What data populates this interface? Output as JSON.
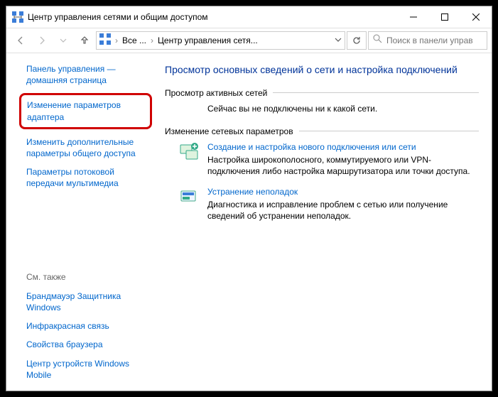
{
  "window": {
    "title": "Центр управления сетями и общим доступом"
  },
  "address": {
    "seg1": "Все ...",
    "seg2": "Центр управления сетя..."
  },
  "search": {
    "placeholder": "Поиск в панели управ"
  },
  "sidebar": {
    "home": "Панель управления — домашняя страница",
    "adapter": "Изменение параметров адаптера",
    "sharing": "Изменить дополнительные параметры общего доступа",
    "media": "Параметры потоковой передачи мультимедиа",
    "seealso": "См. также",
    "firewall": "Брандмауэр Защитника Windows",
    "infrared": "Инфракрасная связь",
    "browser": "Свойства браузера",
    "mobile": "Центр устройств Windows Mobile"
  },
  "main": {
    "heading": "Просмотр основных сведений о сети и настройка подключений",
    "active_h": "Просмотр активных сетей",
    "active_msg": "Сейчас вы не подключены ни к какой сети.",
    "params_h": "Изменение сетевых параметров",
    "opt1_link": "Создание и настройка нового подключения или сети",
    "opt1_desc": "Настройка широкополосного, коммутируемого или VPN-подключения либо настройка маршрутизатора или точки доступа.",
    "opt2_link": "Устранение неполадок",
    "opt2_desc": "Диагностика и исправление проблем с сетью или получение сведений об устранении неполадок."
  }
}
